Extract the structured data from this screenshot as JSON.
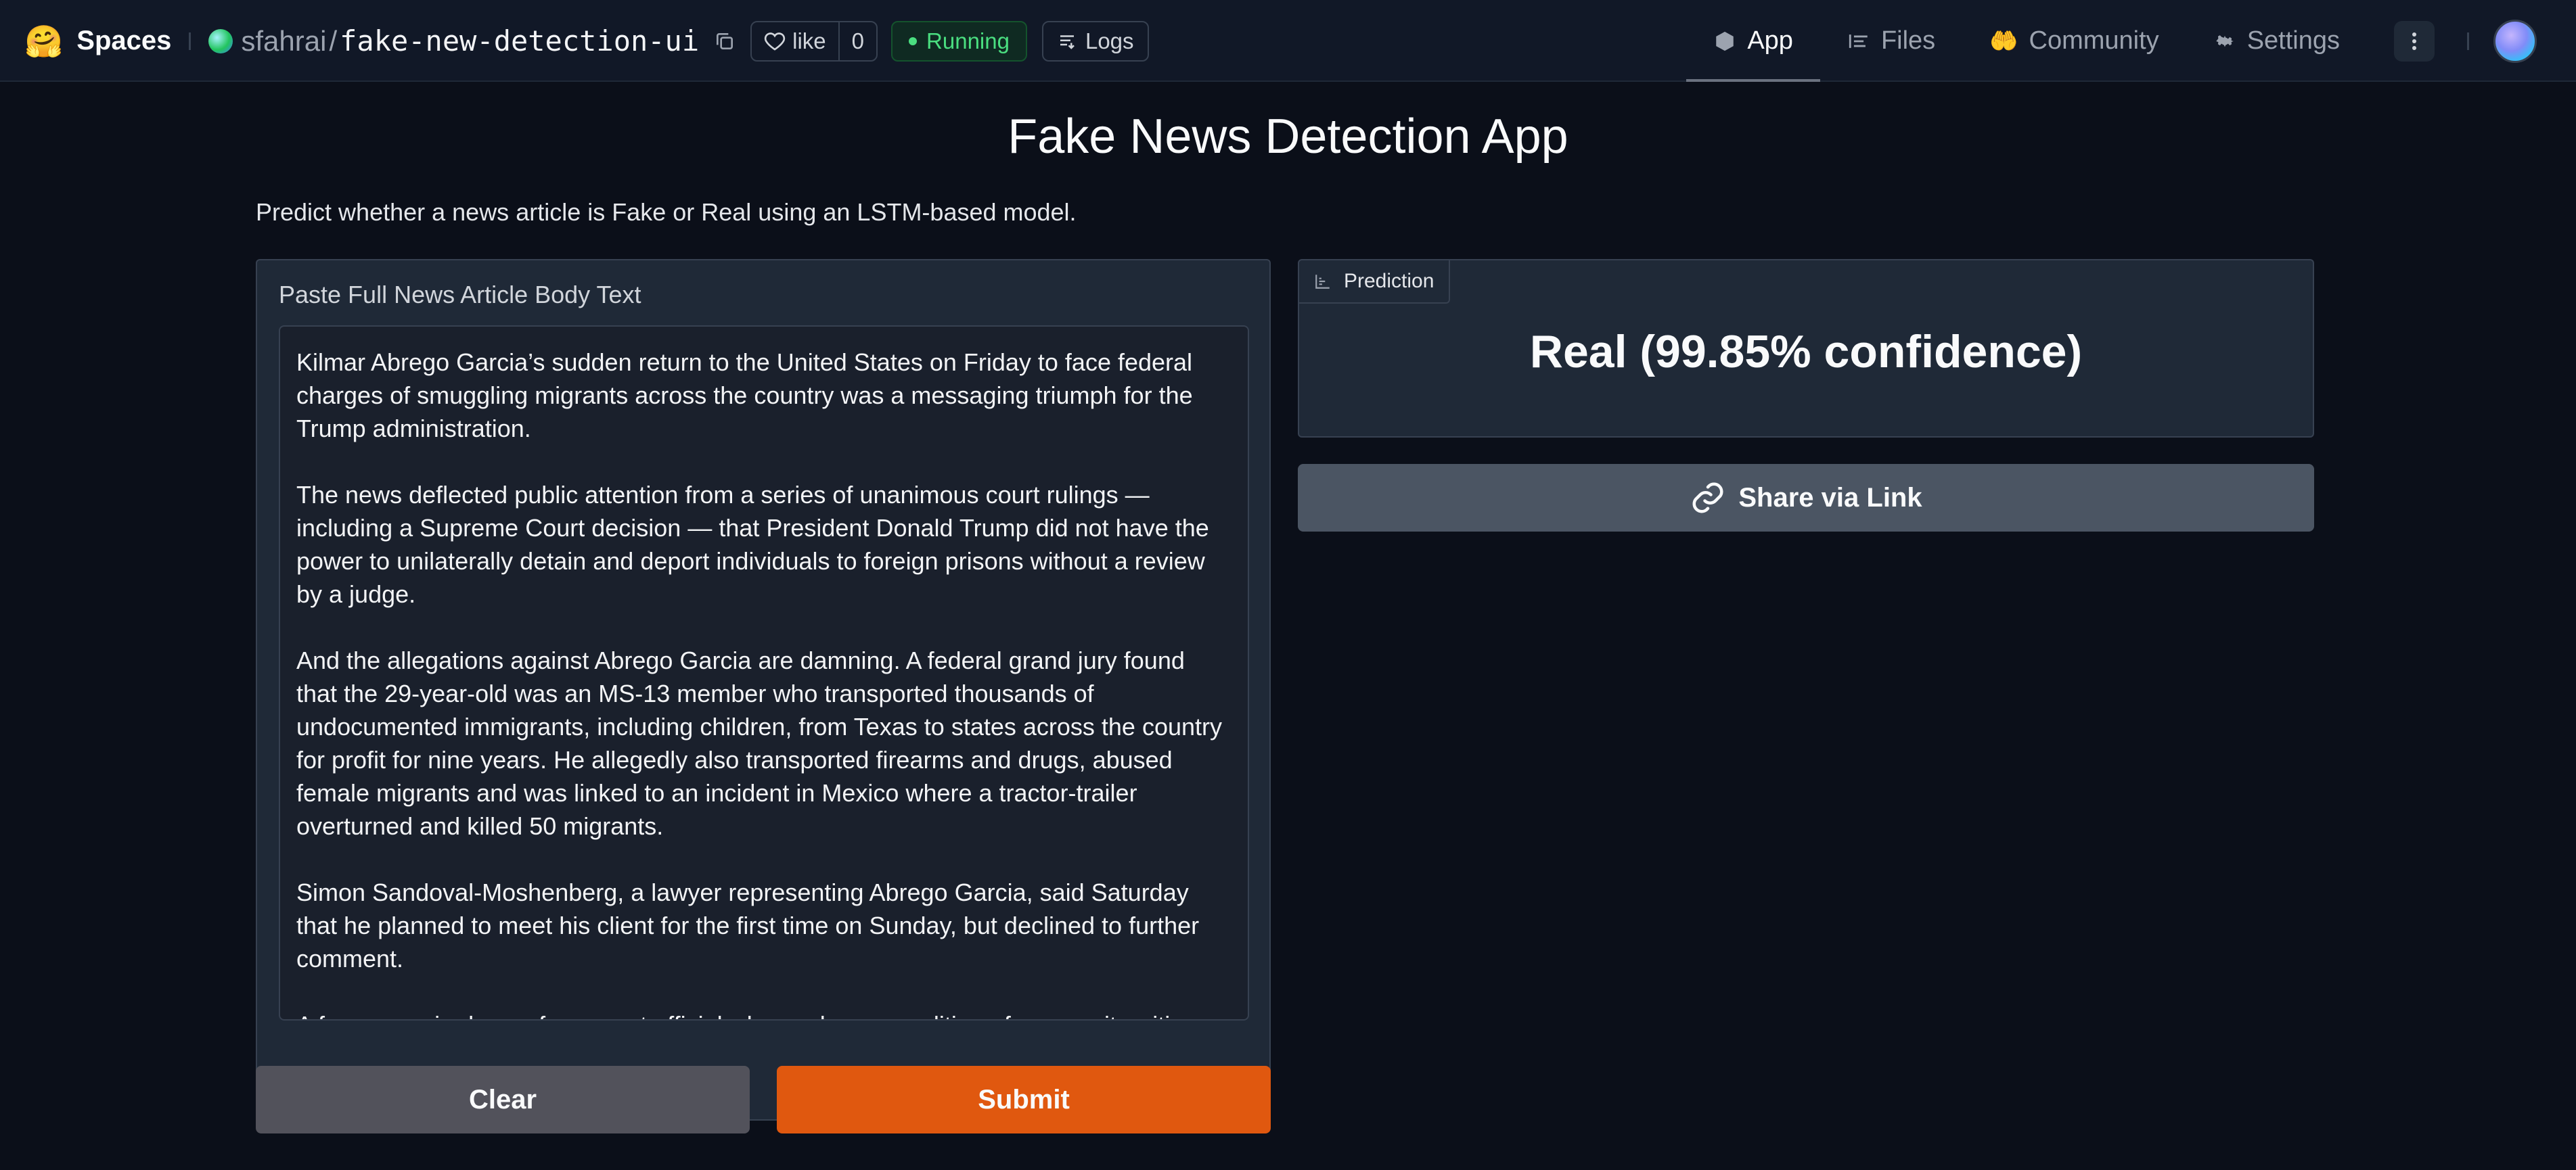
{
  "topbar": {
    "spaces_label": "Spaces",
    "owner": "sfahrai",
    "separator": "/",
    "repo": "fake-new-detection-ui",
    "like_label": "like",
    "like_count": "0",
    "status": "Running",
    "logs_label": "Logs",
    "nav": [
      {
        "label": "App",
        "icon": "cube-icon",
        "active": true
      },
      {
        "label": "Files",
        "icon": "files-icon",
        "active": false
      },
      {
        "label": "Community",
        "icon": "community-icon",
        "active": false
      },
      {
        "label": "Settings",
        "icon": "gear-icon",
        "active": false
      }
    ]
  },
  "app": {
    "title": "Fake News Detection App",
    "description": "Predict whether a news article is Fake or Real using an LSTM-based model.",
    "input_label": "Paste Full News Article Body Text",
    "article_paragraphs": [
      "Kilmar Abrego Garcia’s sudden return to the United States on Friday to face federal charges of smuggling migrants across the country was a messaging triumph for the Trump administration.",
      "The news deflected public attention from a series of unanimous court rulings — including a Supreme Court decision — that President Donald Trump did not have the power to unilaterally detain and deport individuals to foreign prisons without a review by a judge.",
      "And the allegations against Abrego Garcia are damning. A federal grand jury found that the 29-year-old was an MS-13 member who transported thousands of undocumented immigrants, including children, from Texas to states across the country for profit for nine years. He allegedly also transported firearms and drugs, abused female migrants and was linked to an incident in Mexico where a tractor-trailer overturned and killed 50 migrants.",
      "Simon Sandoval-Moshenberg, a lawyer representing Abrego Garcia, said Saturday that he planned to meet his client for the first time on Sunday, but declined to further comment.",
      "A former senior law enforcement official who spoke on condition of anonymity, citing fear of retaliation, said he was struck by the large amount of resources the DOJ put into investigating Abrego Garcia."
    ],
    "clear_label": "Clear",
    "submit_label": "Submit",
    "prediction_label": "Prediction",
    "prediction_value": "Real (99.85% confidence)",
    "share_label": "Share via Link"
  },
  "colors": {
    "accent_submit": "#e0580f",
    "running_green": "#4ade80",
    "background": "#0b0f19",
    "panel": "#1f2937"
  }
}
